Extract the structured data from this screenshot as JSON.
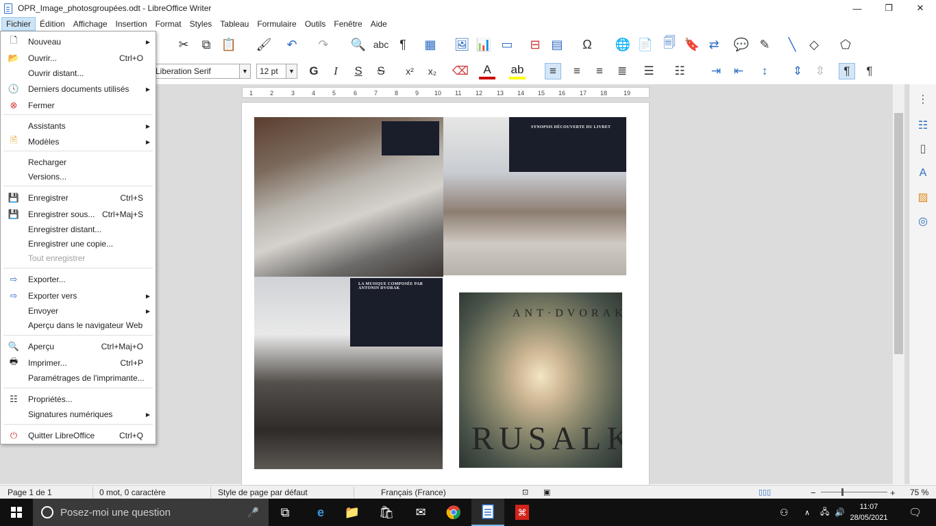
{
  "window": {
    "title": "OPR_Image_photosgroupées.odt - LibreOffice Writer",
    "minimize": "—",
    "maximize": "❐",
    "close": "✕"
  },
  "menubar": [
    "Fichier",
    "Édition",
    "Affichage",
    "Insertion",
    "Format",
    "Styles",
    "Tableau",
    "Formulaire",
    "Outils",
    "Fenêtre",
    "Aide"
  ],
  "toolbar": {
    "font_name": "Liberation Serif",
    "font_size": "12 pt"
  },
  "file_menu": {
    "items": [
      {
        "label": "Nouveau",
        "shortcut": "",
        "submenu": true,
        "icon": "new-document-icon"
      },
      {
        "label": "Ouvrir...",
        "shortcut": "Ctrl+O",
        "submenu": false,
        "icon": "open-folder-icon"
      },
      {
        "label": "Ouvrir distant...",
        "shortcut": "",
        "submenu": false,
        "icon": ""
      },
      {
        "label": "Derniers documents utilisés",
        "shortcut": "",
        "submenu": true,
        "icon": "clock-icon"
      },
      {
        "label": "Fermer",
        "shortcut": "",
        "submenu": false,
        "icon": "close-document-icon"
      },
      {
        "label": "Assistants",
        "shortcut": "",
        "submenu": true,
        "icon": ""
      },
      {
        "label": "Modèles",
        "shortcut": "",
        "submenu": true,
        "icon": "templates-icon"
      },
      {
        "label": "Recharger",
        "shortcut": "",
        "submenu": false,
        "icon": ""
      },
      {
        "label": "Versions...",
        "shortcut": "",
        "submenu": false,
        "icon": ""
      },
      {
        "label": "Enregistrer",
        "shortcut": "Ctrl+S",
        "submenu": false,
        "icon": "save-icon"
      },
      {
        "label": "Enregistrer sous...",
        "shortcut": "Ctrl+Maj+S",
        "submenu": false,
        "icon": "save-as-icon"
      },
      {
        "label": "Enregistrer distant...",
        "shortcut": "",
        "submenu": false,
        "icon": ""
      },
      {
        "label": "Enregistrer une copie...",
        "shortcut": "",
        "submenu": false,
        "icon": ""
      },
      {
        "label": "Tout enregistrer",
        "shortcut": "",
        "submenu": false,
        "icon": "",
        "disabled": true
      },
      {
        "label": "Exporter...",
        "shortcut": "",
        "submenu": false,
        "icon": "export-icon"
      },
      {
        "label": "Exporter vers",
        "shortcut": "",
        "submenu": true,
        "icon": "export-to-icon"
      },
      {
        "label": "Envoyer",
        "shortcut": "",
        "submenu": true,
        "icon": ""
      },
      {
        "label": "Aperçu dans le navigateur Web",
        "shortcut": "",
        "submenu": false,
        "icon": ""
      },
      {
        "label": "Aperçu",
        "shortcut": "Ctrl+Maj+O",
        "submenu": false,
        "icon": "print-preview-icon"
      },
      {
        "label": "Imprimer...",
        "shortcut": "Ctrl+P",
        "submenu": false,
        "icon": "printer-icon"
      },
      {
        "label": "Paramétrages de l'imprimante...",
        "shortcut": "",
        "submenu": false,
        "icon": ""
      },
      {
        "label": "Propriétés...",
        "shortcut": "",
        "submenu": false,
        "icon": "properties-icon"
      },
      {
        "label": "Signatures numériques",
        "shortcut": "",
        "submenu": true,
        "icon": ""
      },
      {
        "label": "Quitter LibreOffice",
        "shortcut": "Ctrl+Q",
        "submenu": false,
        "icon": "power-icon"
      }
    ]
  },
  "ruler_ticks": [
    "1",
    "2",
    "3",
    "4",
    "5",
    "6",
    "7",
    "8",
    "9",
    "10",
    "11",
    "12",
    "13",
    "14",
    "15",
    "16",
    "17",
    "18",
    "19"
  ],
  "document": {
    "slide1_title": "SYNOPSIS DÉCOUVERTE DU LIVRET",
    "slide2_title": "LA MUSIQUE COMPOSÉE PAR ANTONIN DVORAK",
    "poster_composer": "ANT·DVORAK",
    "poster_title": "RUSALKA"
  },
  "statusbar": {
    "page": "Page 1 de 1",
    "words": "0 mot, 0 caractère",
    "page_style": "Style de page par défaut",
    "language": "Français (France)",
    "zoom": "75 %"
  },
  "taskbar": {
    "search_placeholder": "Posez-moi une question",
    "time": "11:07",
    "date": "28/05/2021"
  }
}
